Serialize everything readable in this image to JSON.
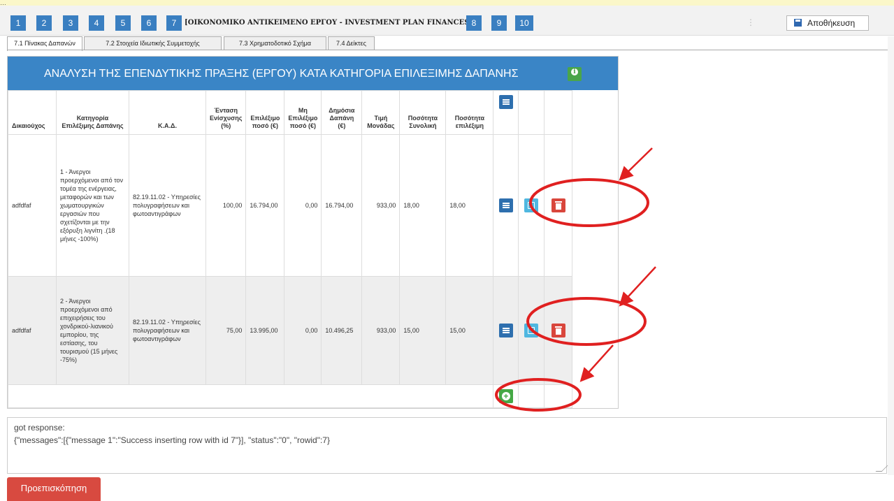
{
  "top_strip_text": "…",
  "toolbar": {
    "steps_left": [
      "1",
      "2",
      "3",
      "4",
      "5",
      "6",
      "7"
    ],
    "section_title": "[ΟΙΚΟΝΟΜΙΚΟ ΑΝΤΙΚΕΙΜΕΝΟ ΕΡΓΟΥ - INVESTMENT PLAN FINANCES]",
    "steps_right": [
      "8",
      "9",
      "10"
    ],
    "save_label": "Αποθήκευση"
  },
  "tabs": [
    "7.1 Πίνακας Δαπανών",
    "7.2 Στοιχεία Ιδιωτικής Συμμετοχής",
    "7.3 Χρηματοδοτικό Σχήμα",
    "7.4 Δείκτες"
  ],
  "table": {
    "title": "ΑΝΑΛΥΣΗ ΤΗΣ ΕΠΕΝΔΥΤΙΚΗΣ ΠΡΑΞΗΣ (ΕΡΓΟΥ) ΚΑΤΑ ΚΑΤΗΓΟΡΙΑ ΕΠΙΛΕΞΙΜΗΣ ΔΑΠΑΝΗΣ",
    "headers": [
      "Δικαιούχος",
      "Κατηγορία Επιλέξιμης Δαπάνης",
      "Κ.Α.Δ.",
      "Ένταση Ενίσχυσης (%)",
      "Επιλέξιμο ποσό (€)",
      "Μη Επιλέξιμο ποσό (€)",
      "Δημόσια Δαπάνη (€)",
      "Τιμή Μονάδας",
      "Ποσότητα Συνολική",
      "Ποσότητα επιλέξιμη"
    ],
    "rows": [
      {
        "beneficiary": "adfdfaf",
        "category": "1 - Άνεργοι προερχόμενοι από τον τομέα της ενέργειας, μεταφορών και των χωματουργικών εργασιών που σχετίζονται με την εξόρυξη λιγνίτη .(18 μήνες -100%)",
        "kad": "82.19.11.02 - Υπηρεσίες πολυγραφήσεων και φωτοαντιγράφων",
        "intensity": "100,00",
        "eligible": "16.794,00",
        "non_eligible": "0,00",
        "public": "16.794,00",
        "unit_price": "933,00",
        "qty_total": "18,00",
        "qty_eligible": "18,00"
      },
      {
        "beneficiary": "adfdfaf",
        "category": "2 - Άνεργοι προερχόμενοι από επιχειρήσεις του χονδρικού-λιανικού εμπορίου, της εστίασης, του τουρισμού (15 μήνες -75%)",
        "kad": "82.19.11.02 - Υπηρεσίες πολυγραφήσεων και φωτοαντιγράφων",
        "intensity": "75,00",
        "eligible": "13.995,00",
        "non_eligible": "0,00",
        "public": "10.496,25",
        "unit_price": "933,00",
        "qty_total": "15,00",
        "qty_eligible": "15,00"
      }
    ]
  },
  "response": {
    "line1": "got response:",
    "line2": "{\"messages\":[{\"message 1\":\"Success inserting row with id 7\"}], \"status\":\"0\", \"rowid\":7}"
  },
  "preview_label": "Προεπισκόπηση",
  "colors": {
    "step_blue": "#3a7fc1",
    "banner_blue": "#3a85c6",
    "annotation_red": "#e02020",
    "preview_red": "#d84a40"
  }
}
